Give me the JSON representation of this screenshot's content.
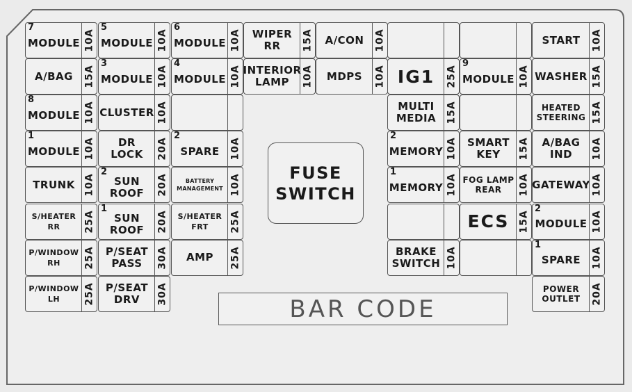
{
  "fuse_switch": {
    "label": "FUSE\nSWITCH"
  },
  "bar_code": {
    "label": "BAR CODE"
  },
  "columns": [
    [
      {
        "number": "7",
        "label": "MODULE",
        "rating": "10A"
      },
      {
        "number": "",
        "label": "A/BAG",
        "rating": "15A"
      },
      {
        "number": "8",
        "label": "MODULE",
        "rating": "10A"
      },
      {
        "number": "1",
        "label": "MODULE",
        "rating": "10A"
      },
      {
        "number": "",
        "label": "TRUNK",
        "rating": "10A"
      },
      {
        "number": "",
        "label": "S/HEATER\nRR",
        "rating": "25A"
      },
      {
        "number": "",
        "label": "P/WINDOW\nRH",
        "rating": "25A"
      },
      {
        "number": "",
        "label": "P/WINDOW\nLH",
        "rating": "25A"
      }
    ],
    [
      {
        "number": "5",
        "label": "MODULE",
        "rating": "10A"
      },
      {
        "number": "3",
        "label": "MODULE",
        "rating": "10A"
      },
      {
        "number": "",
        "label": "CLUSTER",
        "rating": "10A"
      },
      {
        "number": "",
        "label": "DR\nLOCK",
        "rating": "20A"
      },
      {
        "number": "2",
        "label": "SUN\nROOF",
        "rating": "20A"
      },
      {
        "number": "1",
        "label": "SUN\nROOF",
        "rating": "20A"
      },
      {
        "number": "",
        "label": "P/SEAT\nPASS",
        "rating": "30A"
      },
      {
        "number": "",
        "label": "P/SEAT\nDRV",
        "rating": "30A"
      }
    ],
    [
      {
        "number": "6",
        "label": "MODULE",
        "rating": "10A"
      },
      {
        "number": "4",
        "label": "MODULE",
        "rating": "10A"
      },
      {
        "number": "",
        "label": "",
        "rating": ""
      },
      {
        "number": "2",
        "label": "SPARE",
        "rating": "10A"
      },
      {
        "number": "",
        "label": "BATTERY\nMANAGEMENT",
        "rating": "10A"
      },
      {
        "number": "",
        "label": "S/HEATER\nFRT",
        "rating": "25A"
      },
      {
        "number": "",
        "label": "AMP",
        "rating": "25A"
      }
    ],
    [
      {
        "number": "",
        "label": "WIPER\nRR",
        "rating": "15A"
      },
      {
        "number": "",
        "label": "INTERIOR\nLAMP",
        "rating": "10A"
      }
    ],
    [
      {
        "number": "",
        "label": "A/CON",
        "rating": "10A"
      },
      {
        "number": "",
        "label": "MDPS",
        "rating": "10A"
      }
    ],
    [
      {
        "number": "",
        "label": "",
        "rating": ""
      },
      {
        "number": "",
        "label": "IG1",
        "rating": "25A"
      },
      {
        "number": "",
        "label": "MULTI\nMEDIA",
        "rating": "15A"
      },
      {
        "number": "2",
        "label": "MEMORY",
        "rating": "10A"
      },
      {
        "number": "1",
        "label": "MEMORY",
        "rating": "10A"
      },
      {
        "number": "",
        "label": "",
        "rating": ""
      },
      {
        "number": "",
        "label": "BRAKE\nSWITCH",
        "rating": "10A"
      }
    ],
    [
      {
        "number": "",
        "label": "",
        "rating": ""
      },
      {
        "number": "9",
        "label": "MODULE",
        "rating": "10A"
      },
      {
        "number": "",
        "label": "",
        "rating": ""
      },
      {
        "number": "",
        "label": "SMART\nKEY",
        "rating": "15A"
      },
      {
        "number": "",
        "label": "FOG LAMP\nREAR",
        "rating": "10A"
      },
      {
        "number": "",
        "label": "ECS",
        "rating": "15A"
      },
      {
        "number": "",
        "label": "",
        "rating": ""
      }
    ],
    [
      {
        "number": "",
        "label": "START",
        "rating": "10A"
      },
      {
        "number": "",
        "label": "WASHER",
        "rating": "15A"
      },
      {
        "number": "",
        "label": "HEATED\nSTEERING",
        "rating": "15A"
      },
      {
        "number": "",
        "label": "A/BAG\nIND",
        "rating": "10A"
      },
      {
        "number": "",
        "label": "GATEWAY",
        "rating": "10A"
      },
      {
        "number": "2",
        "label": "MODULE",
        "rating": "10A"
      },
      {
        "number": "1",
        "label": "SPARE",
        "rating": "10A"
      },
      {
        "number": "",
        "label": "POWER\nOUTLET",
        "rating": "20A"
      }
    ]
  ]
}
